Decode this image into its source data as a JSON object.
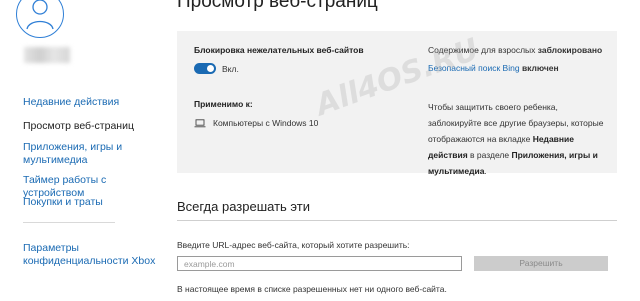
{
  "sidebar": {
    "items": [
      {
        "label": "Недавние действия"
      },
      {
        "label": "Просмотр веб-страниц"
      },
      {
        "label": "Приложения, игры и мультимедиа"
      },
      {
        "label": "Таймер работы с устройством"
      },
      {
        "label": "Покупки и траты"
      },
      {
        "label": "Параметры конфиденциальности Xbox"
      }
    ],
    "active_index": 1
  },
  "page": {
    "title": "Просмотр веб-страниц"
  },
  "blocking": {
    "heading": "Блокировка нежелательных веб-сайтов",
    "toggle_label": "Вкл.",
    "toggle_on": true
  },
  "applies": {
    "heading": "Применимо к:",
    "device": "Компьютеры с Windows 10",
    "device_icon": "laptop-icon"
  },
  "adult": {
    "prefix": "Содержимое для взрослых",
    "status": "заблокировано",
    "safe_search_link": "Безопасный поиск Bing",
    "safe_search_status": "включен"
  },
  "protect": {
    "text_1": "Чтобы защитить своего ребенка, заблокируйте все другие браузеры, которые отображаются на вкладке",
    "bold_1": "Недавние действия",
    "text_2": "в разделе",
    "bold_2": "Приложения, игры и мультимедиа",
    "text_3": "."
  },
  "always_allow": {
    "title": "Всегда разрешать эти",
    "input_label": "Введите URL-адрес веб-сайта, который хотите разрешить:",
    "input_placeholder": "example.com",
    "input_value": "",
    "button_label": "Разрешить",
    "empty_note": "В настоящее время в списке разрешенных нет ни одного веб-сайта."
  },
  "watermark": "All4OS.RU",
  "colors": {
    "accent": "#1a6ab3",
    "panel": "#f2f2f2",
    "avatar_ring": "#2f7fd6"
  }
}
